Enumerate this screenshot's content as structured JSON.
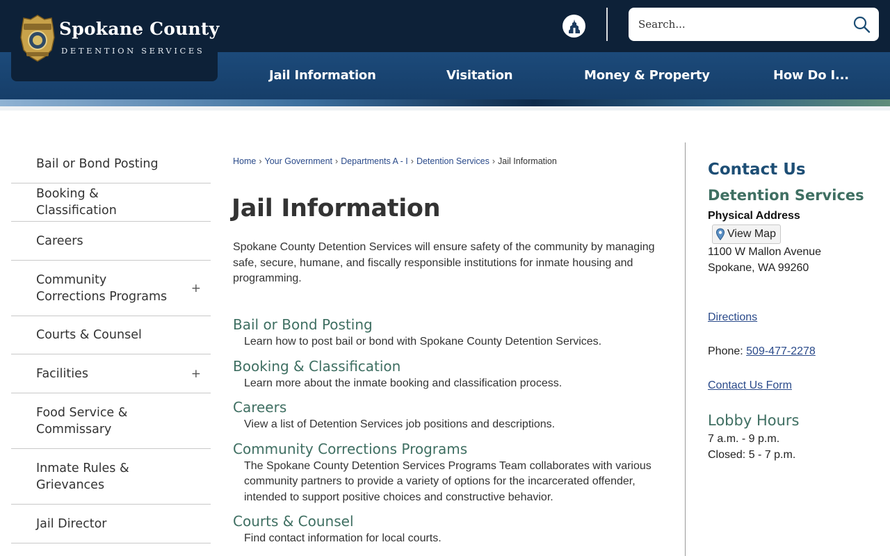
{
  "header": {
    "logo_title": "Spokane County",
    "logo_subtitle": "DETENTION SERVICES",
    "search_placeholder": "Search...",
    "nav": [
      {
        "label": "Jail Information"
      },
      {
        "label": "Visitation"
      },
      {
        "label": "Money & Property"
      },
      {
        "label": "How Do I..."
      }
    ]
  },
  "sidebar": {
    "items": [
      {
        "label": "Bail or Bond Posting",
        "expandable": false
      },
      {
        "label": "Booking & Classification",
        "expandable": false
      },
      {
        "label": "Careers",
        "expandable": false
      },
      {
        "label": "Community Corrections Programs",
        "expandable": true
      },
      {
        "label": "Courts & Counsel",
        "expandable": false
      },
      {
        "label": "Facilities",
        "expandable": true
      },
      {
        "label": "Food Service & Commissary",
        "expandable": false
      },
      {
        "label": "Inmate Rules & Grievances",
        "expandable": false
      },
      {
        "label": "Jail Director",
        "expandable": false
      }
    ],
    "expand_symbol": "+"
  },
  "breadcrumb": {
    "links": [
      "Home",
      "Your Government",
      "Departments A - I",
      "Detention Services"
    ],
    "current": "Jail Information",
    "separator": "›"
  },
  "main": {
    "title": "Jail Information",
    "intro": "Spokane County Detention Services will ensure safety of the community by managing safe, secure, humane, and fiscally responsible institutions for inmate housing and programming.",
    "links": [
      {
        "title": "Bail or Bond Posting",
        "desc": "Learn how to post bail or bond with Spokane County Detention Services."
      },
      {
        "title": "Booking & Classification",
        "desc": "Learn more about the inmate booking and classification process."
      },
      {
        "title": "Careers",
        "desc": "View a list of Detention Services job positions and descriptions."
      },
      {
        "title": "Community Corrections Programs",
        "desc": "The Spokane County Detention Services Programs Team collaborates with various community partners to provide a variety of options for the incarcerated offender, intended to support positive choices and constructive behavior."
      },
      {
        "title": "Courts & Counsel",
        "desc": "Find contact information for local courts."
      }
    ]
  },
  "contact": {
    "heading": "Contact Us",
    "department": "Detention Services",
    "address_label": "Physical Address",
    "view_map": "View Map",
    "address_line1": "1100 W Mallon Avenue",
    "address_line2": "Spokane, WA 99260",
    "directions": "Directions",
    "phone_label": "Phone: ",
    "phone": "509-477-2278",
    "form_link": "Contact Us Form",
    "lobby_heading": "Lobby Hours",
    "lobby_line1": "7 a.m. - 9 p.m.",
    "lobby_line2": "Closed: 5 - 7 p.m."
  },
  "colors": {
    "header_dark": "#0d2138",
    "nav_blue": "#1c4a7a",
    "accent_green": "#3f6f62",
    "heading_blue": "#1d4e75",
    "link_blue": "#2a4a8a"
  }
}
